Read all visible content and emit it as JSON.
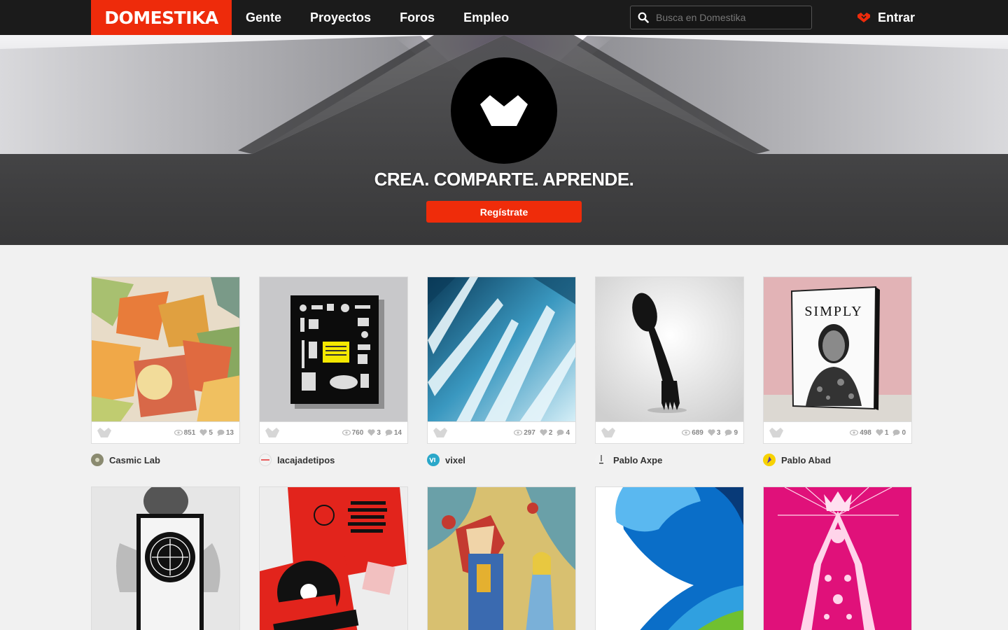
{
  "brand": {
    "name": "DOMESTIKA",
    "color": "#ee2b0b"
  },
  "nav": {
    "items": [
      {
        "label": "Gente"
      },
      {
        "label": "Proyectos"
      },
      {
        "label": "Foros"
      },
      {
        "label": "Empleo"
      }
    ]
  },
  "search": {
    "placeholder": "Busca en Domestika",
    "value": ""
  },
  "login": {
    "label": "Entrar"
  },
  "hero": {
    "tagline": "CREA. COMPARTE. APRENDE.",
    "cta_label": "Regístrate"
  },
  "projects": [
    {
      "owner": "Casmic Lab",
      "views": "851",
      "likes": "5",
      "comments": "13",
      "theme": "low-poly-fruit",
      "avatar_color": "#8a8a70"
    },
    {
      "owner": "lacajadetipos",
      "views": "760",
      "likes": "3",
      "comments": "14",
      "theme": "black-poster",
      "avatar_color": "#f2f2f2"
    },
    {
      "owner": "vixel",
      "views": "297",
      "likes": "2",
      "comments": "4",
      "theme": "blue-abstract",
      "avatar_color": "#2aa7c9"
    },
    {
      "owner": "Pablo Axpe",
      "views": "689",
      "likes": "3",
      "comments": "9",
      "theme": "spork",
      "avatar_color": "#f2f2f2"
    },
    {
      "owner": "Pablo Abad",
      "views": "498",
      "likes": "1",
      "comments": "0",
      "theme": "simply-magazine",
      "avatar_color": "#f7d200"
    },
    {
      "owner": "",
      "views": "",
      "likes": "",
      "comments": "",
      "theme": "man-with-frame",
      "avatar_color": ""
    },
    {
      "owner": "",
      "views": "",
      "likes": "",
      "comments": "",
      "theme": "red-vinyl",
      "avatar_color": ""
    },
    {
      "owner": "",
      "views": "",
      "likes": "",
      "comments": "",
      "theme": "alice-illustration",
      "avatar_color": ""
    },
    {
      "owner": "",
      "views": "",
      "likes": "",
      "comments": "",
      "theme": "blue-swirl",
      "avatar_color": ""
    },
    {
      "owner": "",
      "views": "",
      "likes": "",
      "comments": "",
      "theme": "pink-virgin",
      "avatar_color": ""
    }
  ],
  "magazine_title": "SIMPLY"
}
